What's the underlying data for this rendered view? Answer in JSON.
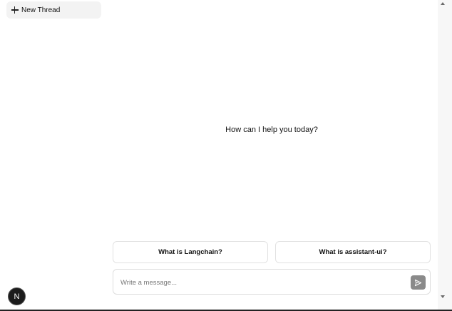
{
  "sidebar": {
    "new_thread_label": "New Thread",
    "avatar_letter": "N"
  },
  "main": {
    "welcome_text": "How can I help you today?",
    "suggestions": [
      {
        "label": "What is Langchain?"
      },
      {
        "label": "What is assistant-ui?"
      }
    ],
    "composer": {
      "placeholder": "Write a message...",
      "value": ""
    }
  },
  "colors": {
    "sidebar_button_bg": "#f3f3f3",
    "send_button_bg": "#8a8a8a",
    "avatar_bg": "#1c1c1c"
  },
  "icons": {
    "new_thread": "plus-icon",
    "send": "send-icon"
  }
}
